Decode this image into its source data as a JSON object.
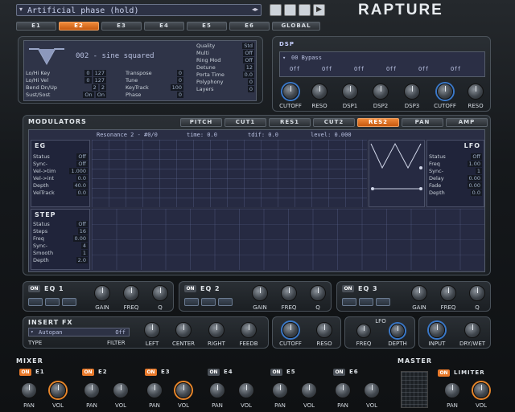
{
  "preset": {
    "name": "Artificial phase (hold)"
  },
  "logo": "RAPTURE",
  "element_tabs": [
    "E1",
    "E2",
    "E3",
    "E4",
    "E5",
    "E6",
    "GLOBAL"
  ],
  "osc": {
    "waveform_name": "002 - sine squared",
    "rows_left": [
      [
        "Lo/Hi Key",
        "0",
        "127"
      ],
      [
        "Lo/Hi Vel",
        "0",
        "127"
      ],
      [
        "Bend Dn/Up",
        "2",
        "2"
      ],
      [
        "Sust/Sost",
        "On",
        "On"
      ]
    ],
    "rows_mid": [
      [
        "Transpose",
        "0"
      ],
      [
        "Tune",
        "0"
      ],
      [
        "KeyTrack",
        "100"
      ],
      [
        "Phase",
        "0"
      ]
    ],
    "rows_right": [
      [
        "Quality",
        "Std"
      ],
      [
        "Multi",
        "Off"
      ],
      [
        "Ring Mod",
        "Off"
      ],
      [
        "Detune",
        "12"
      ],
      [
        "Porta Time",
        "0.0"
      ],
      [
        "Polyphony",
        "0"
      ],
      [
        "Layers",
        "0"
      ]
    ]
  },
  "dsp": {
    "title": "DSP",
    "slot_label": "00  Bypass",
    "offs": [
      "Off",
      "Off",
      "Off",
      "Off",
      "Off",
      "Off"
    ],
    "knobs": [
      "CUTOFF",
      "RESO",
      "DSP1",
      "DSP2",
      "DSP3",
      "CUTOFF",
      "RESO"
    ]
  },
  "modulators": {
    "title": "MODULATORS",
    "tabs": [
      "PITCH",
      "CUT1",
      "RES1",
      "CUT2",
      "RES2",
      "PAN",
      "AMP"
    ],
    "status_line": {
      "target": "Resonance 2 - #0/0",
      "time": "time: 0.0",
      "tdif": "tdif: 0.0",
      "level": "level: 0.000"
    },
    "eg": {
      "title": "EG",
      "rows": [
        [
          "Status",
          "Off"
        ],
        [
          "Sync-",
          "Off"
        ],
        [
          "Vel->tim",
          "1.000"
        ],
        [
          "Vel->int",
          "0.0"
        ],
        [
          "Depth",
          "40.0"
        ],
        [
          "VelTrack",
          "0.0"
        ]
      ]
    },
    "lfo": {
      "title": "LFO",
      "rows": [
        [
          "Status",
          "Off"
        ],
        [
          "Freq",
          "1.00"
        ],
        [
          "Sync-",
          "1"
        ],
        [
          "Delay",
          "0.00"
        ],
        [
          "Fade",
          "0.00"
        ],
        [
          "Depth",
          "0.0"
        ]
      ]
    },
    "step": {
      "title": "STEP",
      "rows": [
        [
          "Status",
          "Off"
        ],
        [
          "Steps",
          "16"
        ],
        [
          "Freq",
          "0.00"
        ],
        [
          "Sync-",
          "4"
        ],
        [
          "Smooth",
          "1"
        ],
        [
          "Depth",
          "2.0"
        ]
      ]
    }
  },
  "eq": [
    {
      "title": "EQ 1",
      "on": "ON",
      "knobs": [
        "GAIN",
        "FREQ",
        "Q"
      ]
    },
    {
      "title": "EQ 2",
      "on": "ON",
      "knobs": [
        "GAIN",
        "FREQ",
        "Q"
      ]
    },
    {
      "title": "EQ 3",
      "on": "ON",
      "knobs": [
        "GAIN",
        "FREQ",
        "Q"
      ]
    }
  ],
  "insert_fx": {
    "title": "INSERT FX",
    "type_value": "Autopan",
    "type_label": "TYPE",
    "filter_value": "Off",
    "filter_label": "FILTER",
    "knobs": [
      "LEFT",
      "CENTER",
      "RIGHT",
      "FEEDB"
    ],
    "filter_knobs": [
      "CUTOFF",
      "RESO"
    ],
    "lfo_title": "LFO",
    "lfo_knobs": [
      "FREQ",
      "DEPTH"
    ],
    "io_knobs": [
      "INPUT",
      "DRY/WET"
    ]
  },
  "mixer": {
    "title": "MIXER",
    "channels": [
      {
        "name": "E1",
        "on": "ON",
        "active": true
      },
      {
        "name": "E2",
        "on": "ON",
        "active": true
      },
      {
        "name": "E3",
        "on": "ON",
        "active": true
      },
      {
        "name": "E4",
        "on": "ON",
        "active": false
      },
      {
        "name": "E5",
        "on": "ON",
        "active": false
      },
      {
        "name": "E6",
        "on": "ON",
        "active": false
      }
    ],
    "pan_label": "PAN",
    "vol_label": "VOL"
  },
  "master": {
    "title": "MASTER",
    "limiter_on": "ON",
    "limiter_label": "LIMITER",
    "pan_label": "PAN",
    "vol_label": "VOL"
  },
  "colors": {
    "accent": "#e8792a",
    "blue": "#3a78c8",
    "lcd": "#2b2f45"
  }
}
